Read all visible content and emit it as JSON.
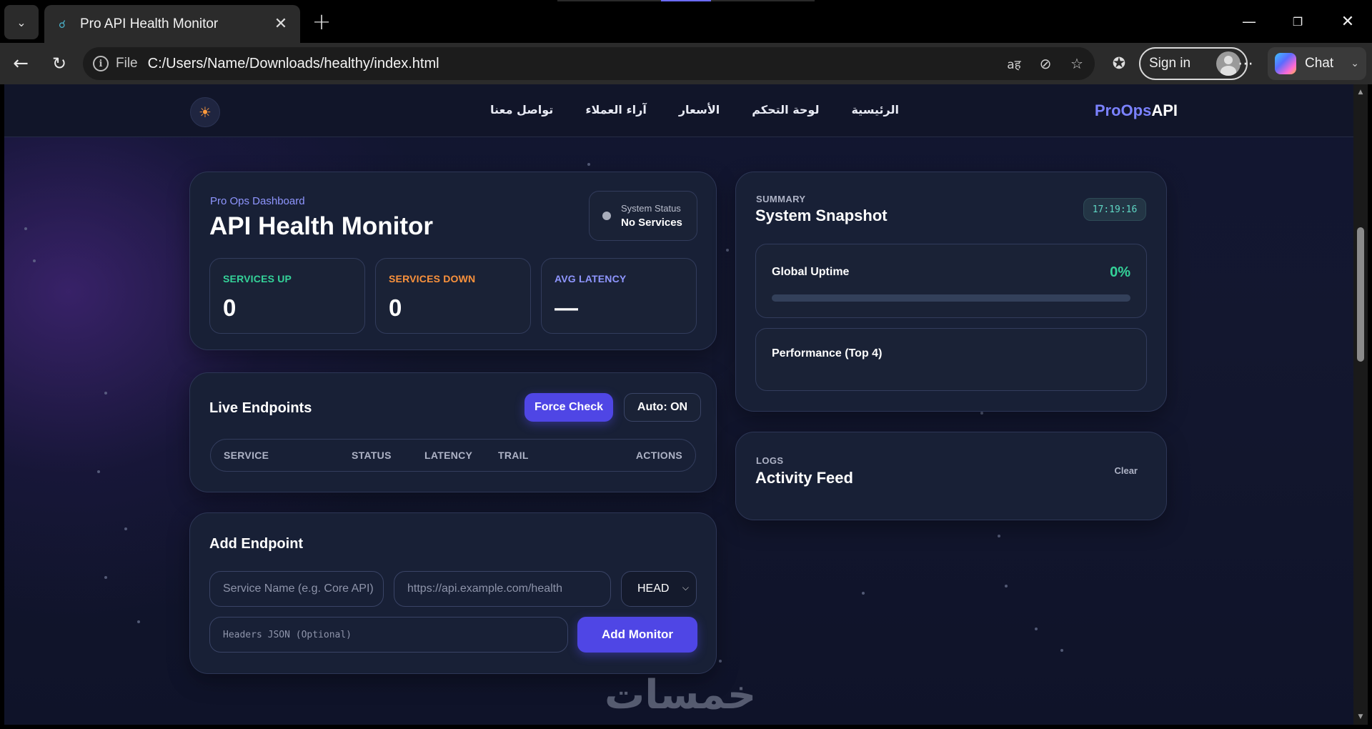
{
  "browser": {
    "tab_title": "Pro API Health Monitor",
    "address_scheme": "File",
    "address_url": "C:/Users/Name/Downloads/healthy/index.html",
    "sign_in_label": "Sign in",
    "chat_label": "Chat"
  },
  "header": {
    "brand_pro": "ProOps",
    "brand_api": "API",
    "nav": [
      "الرئيسية",
      "لوحة التحكم",
      "الأسعار",
      "آراء العملاء",
      "تواصل معنا"
    ]
  },
  "hero": {
    "eyebrow": "Pro Ops Dashboard",
    "title": "API Health Monitor",
    "system_status_label": "System Status",
    "system_status_value": "No Services",
    "stats": [
      {
        "label": "SERVICES UP",
        "value": "0",
        "color": "#34d399"
      },
      {
        "label": "SERVICES DOWN",
        "value": "0",
        "color": "#fb923c"
      },
      {
        "label": "AVG LATENCY",
        "value": "—",
        "color": "#8f96ff"
      }
    ]
  },
  "endpoints": {
    "title": "Live Endpoints",
    "force_check_label": "Force Check",
    "auto_label": "Auto: ON",
    "columns": [
      "SERVICE",
      "STATUS",
      "LATENCY",
      "TRAIL",
      "ACTIONS"
    ]
  },
  "add_endpoint": {
    "title": "Add Endpoint",
    "name_placeholder": "Service Name (e.g. Core API)",
    "url_placeholder": "https://api.example.com/health",
    "method": "HEAD",
    "headers_placeholder": "Headers JSON (Optional)",
    "submit_label": "Add Monitor"
  },
  "summary": {
    "eyebrow": "SUMMARY",
    "title": "System Snapshot",
    "clock": "17:19:16",
    "uptime_label": "Global Uptime",
    "uptime_value": "0%",
    "uptime_fraction": 0,
    "performance_label": "Performance (Top 4)"
  },
  "logs": {
    "eyebrow": "LOGS",
    "title": "Activity Feed",
    "clear_label": "Clear"
  },
  "watermark": "خمسات"
}
